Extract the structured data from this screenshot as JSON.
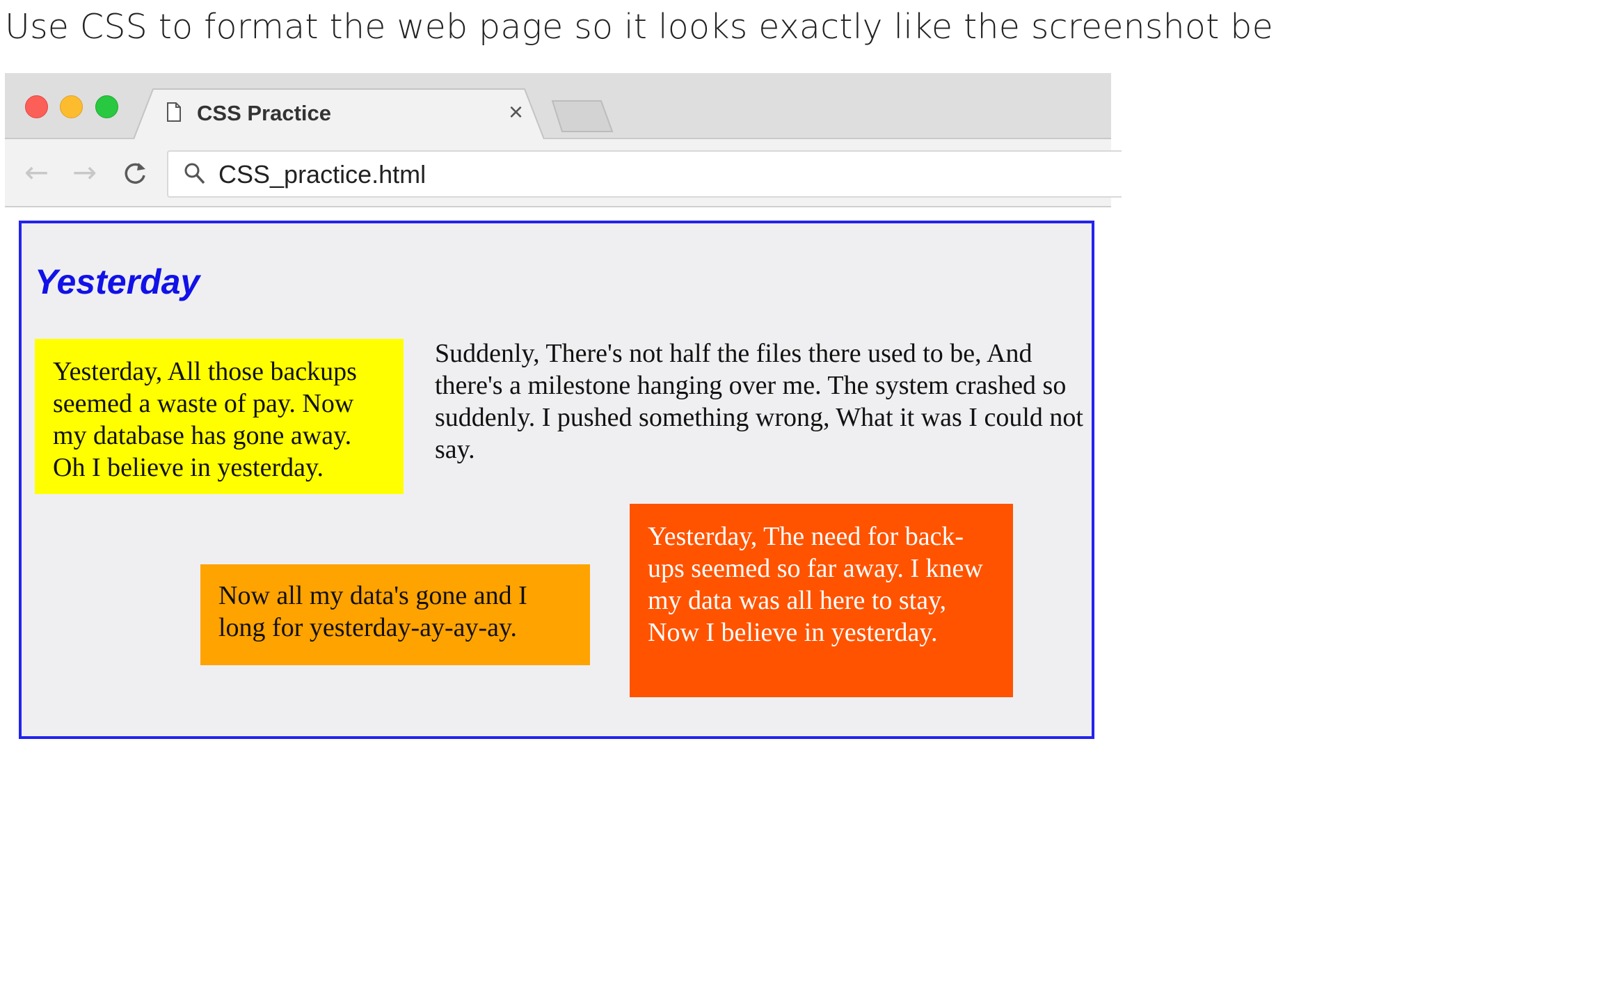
{
  "instruction": "Use CSS to format the web page so it looks exactly like the screenshot be",
  "browser": {
    "tab": {
      "title": "CSS Practice",
      "close_glyph": "×",
      "icon": "document-icon"
    },
    "nav": {
      "back_glyph": "←",
      "forward_glyph": "→",
      "reload_glyph": "C"
    },
    "address": {
      "url": "CSS_practice.html",
      "icon": "search-icon"
    },
    "window_controls": [
      "close",
      "minimize",
      "zoom"
    ]
  },
  "page": {
    "title": "Yesterday",
    "yellow_box": "Yesterday, All those backups seemed a waste of pay. Now my database has gone away. Oh I believe in yesterday.",
    "right_paragraph": "Suddenly, There's not half the files there used to be, And there's a milestone hanging over me. The system crashed so suddenly. I pushed something wrong, What it was I could not say.",
    "orange_box": "Now all my data's gone and I long for yesterday-ay-ay-ay.",
    "red_box": "Yesterday, The need for back-ups seemed so far away. I knew my data was all here to stay, Now I believe in yesterday."
  },
  "colors": {
    "page_border": "#2323ee",
    "title": "#1111e8",
    "yellow": "#ffff00",
    "orange": "#ffa300",
    "red_orange": "#ff5300",
    "page_background": "#efeff1"
  }
}
